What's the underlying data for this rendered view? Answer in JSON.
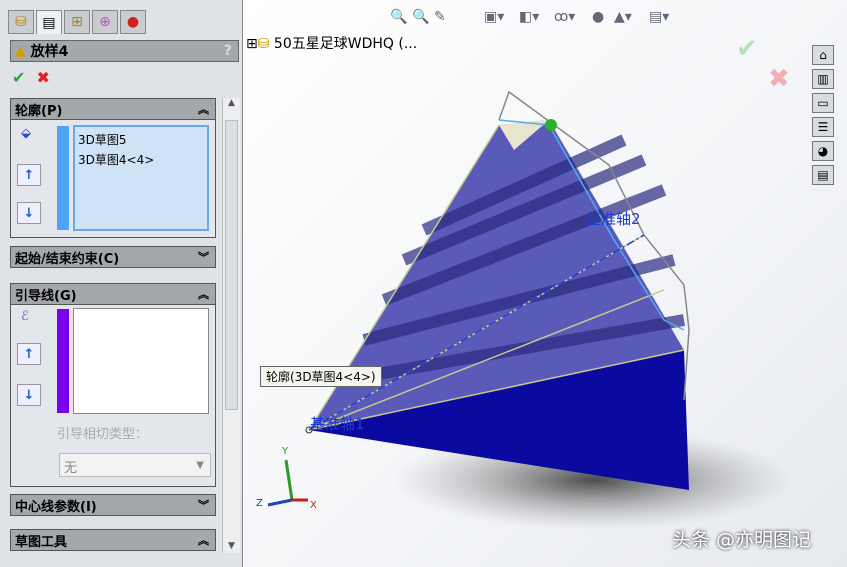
{
  "tabs": [
    "feature-manager",
    "property-manager",
    "configuration-manager",
    "dimxpert",
    "display-manager"
  ],
  "panel": {
    "title": "放样4",
    "help": "?",
    "ok": "✔",
    "cancel": "✖"
  },
  "profile": {
    "title": "轮廓(P)",
    "items": [
      "3D草图5",
      "3D草图4<4>"
    ],
    "bar_color": "#4da3f5"
  },
  "start_end": {
    "title": "起始/结束约束(C)"
  },
  "guide": {
    "title": "引导线(G)",
    "tangent_label": "引导相切类型：",
    "tangent_value": "无",
    "bar_color": "#7a00f0"
  },
  "centerline": {
    "title": "中心线参数(I)"
  },
  "sketch_tools": {
    "title": "草图工具"
  },
  "tree": {
    "expand": "⊞",
    "name": "50五星足球WDHQ  (..."
  },
  "viewport": {
    "axis2": "基准轴2",
    "axis1": "基准轴1",
    "tooltip": "轮廓(3D草图4<4>)",
    "x": "X",
    "y": "Y",
    "z": "Z"
  },
  "watermark": "头条 @亦明图记"
}
